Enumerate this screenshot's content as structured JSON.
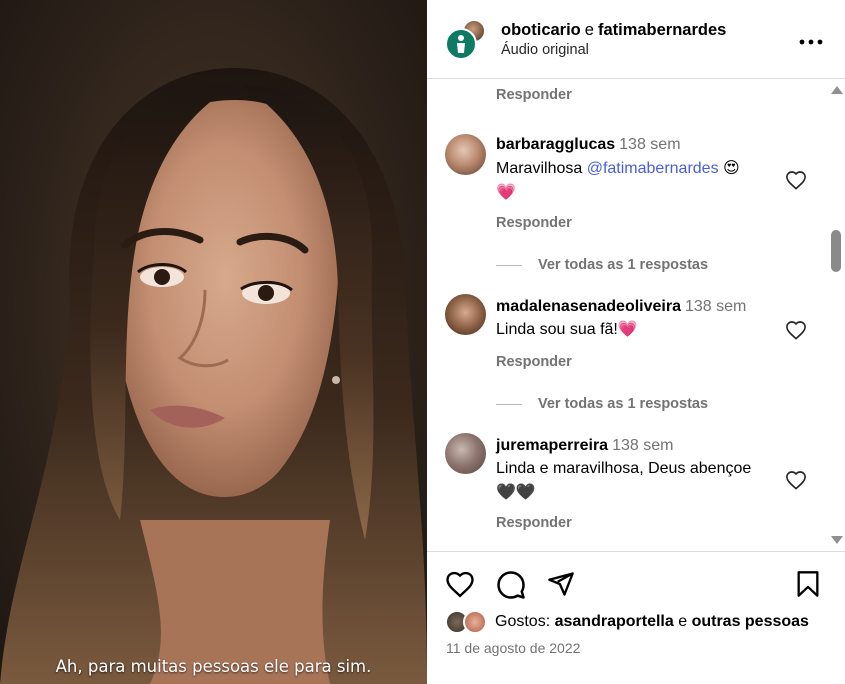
{
  "video": {
    "caption": "Ah, para muitas pessoas ele para sim."
  },
  "header": {
    "user1": "oboticario",
    "separator": "e",
    "user2": "fatimabernardes",
    "audio": "Áudio original",
    "more_icon": "more-horizontal-icon"
  },
  "comments": {
    "top_reply": "Responder",
    "items": [
      {
        "username": "barbaragglucas",
        "time": "138 sem",
        "text_before": "Maravilhosa",
        "mention": "@fatimabernardes",
        "emoji": "😍",
        "emoji2": "💗",
        "reply": "Responder",
        "view_replies": "Ver todas as 1 respostas"
      },
      {
        "username": "madalenasenadeoliveira",
        "time": "138 sem",
        "text": "Linda sou sua fã!",
        "emoji": "💗",
        "reply": "Responder",
        "view_replies": "Ver todas as 1 respostas"
      },
      {
        "username": "juremaperreira",
        "time": "138 sem",
        "text": "Linda e maravilhosa, Deus abençoe",
        "emoji": "🖤🖤",
        "reply": "Responder"
      }
    ]
  },
  "actions": {
    "icons": [
      "heart-icon",
      "comment-icon",
      "share-icon",
      "bookmark-icon"
    ],
    "likes_prefix": "Gostos:",
    "likes_user": "asandraportella",
    "likes_conj": "e",
    "likes_rest": "outras pessoas",
    "date": "11 de agosto de 2022"
  },
  "colors": {
    "mention": "#4a5fd6",
    "secondary_text": "#737373",
    "border": "#dbdbdb",
    "brand_avatar": "#0f7a64"
  }
}
